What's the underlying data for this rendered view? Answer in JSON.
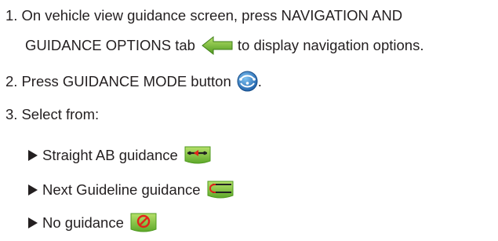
{
  "steps": {
    "step1": {
      "num": "1.",
      "line1": "On vehicle view guidance screen, press NAVIGATION AND",
      "line2_before": "GUIDANCE OPTIONS tab",
      "line2_after": "to display navigation options.",
      "icon": "green-left-arrow-icon"
    },
    "step2": {
      "num": "2.",
      "text_before": "Press GUIDANCE MODE button",
      "text_after": ".",
      "icon": "guidance-mode-icon"
    },
    "step3": {
      "num": "3.",
      "text": "Select from:"
    }
  },
  "options": [
    {
      "label": "Straight AB guidance",
      "icon": "straight-ab-icon"
    },
    {
      "label": "Next Guideline guidance",
      "icon": "next-guideline-icon"
    },
    {
      "label": "No guidance",
      "icon": "no-guidance-icon"
    }
  ],
  "colors": {
    "text": "#231f20",
    "green": "#8dc63f",
    "green_dark": "#4f9a1f",
    "red": "#e2231a",
    "blue": "#2b7bc4"
  }
}
